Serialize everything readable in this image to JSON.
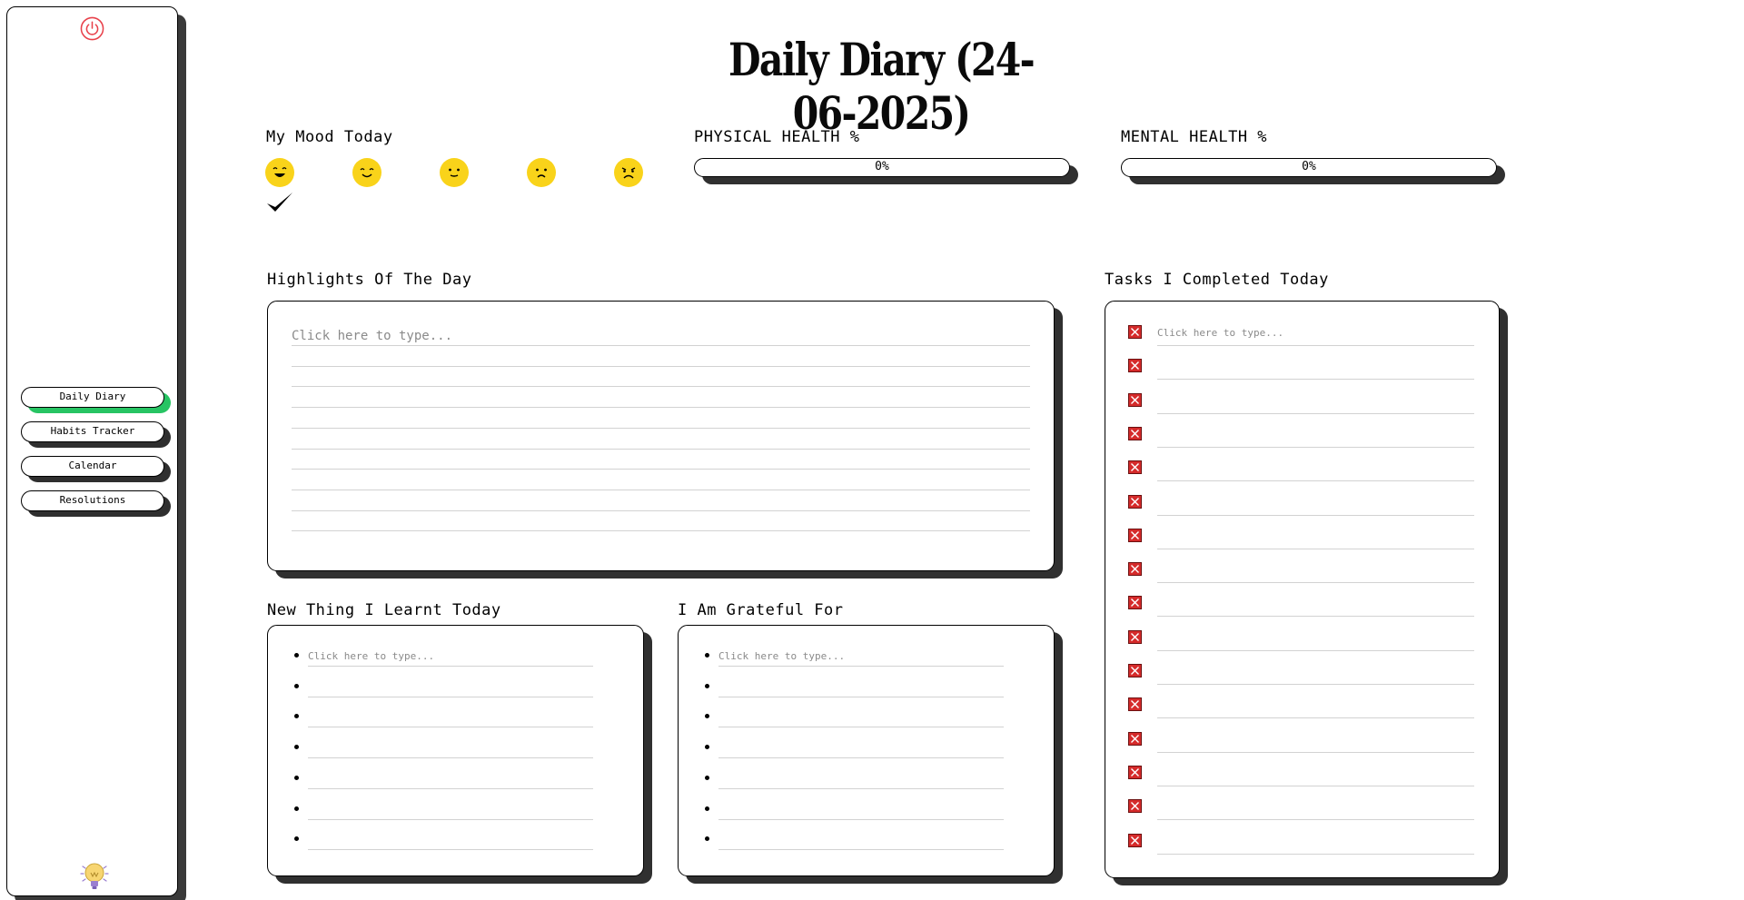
{
  "sidebar": {
    "nav": [
      {
        "label": "Daily Diary",
        "active": true
      },
      {
        "label": "Habits Tracker",
        "active": false
      },
      {
        "label": "Calendar",
        "active": false
      },
      {
        "label": "Resolutions",
        "active": false
      }
    ],
    "icons": {
      "top": "power-icon",
      "bottom": "lightbulb-icon"
    },
    "active_color": "#27c463",
    "power_color": "#e8404a"
  },
  "title": "Daily Diary (24-06-2025)",
  "mood": {
    "label": "My Mood Today",
    "options": [
      "very-happy-face-icon",
      "happy-face-icon",
      "neutral-face-icon",
      "sad-face-icon",
      "very-sad-face-icon"
    ],
    "selected_index": 0,
    "face_color": "#f9d31a"
  },
  "physical": {
    "label": "PHYSICAL HEALTH %",
    "value_text": "0%",
    "value": 0
  },
  "mental": {
    "label": "MENTAL HEALTH %",
    "value_text": "0%",
    "value": 0
  },
  "highlights": {
    "label": "Highlights Of The Day",
    "placeholder": "Click here to type..."
  },
  "learnt": {
    "label": "New Thing I Learnt Today",
    "placeholder": "Click here to type..."
  },
  "grateful": {
    "label": "I Am Grateful For",
    "placeholder": "Click here to type..."
  },
  "tasks": {
    "label": "Tasks I Completed Today",
    "placeholder": "Click here to type...",
    "checkbox_color": "#d52b2b"
  }
}
